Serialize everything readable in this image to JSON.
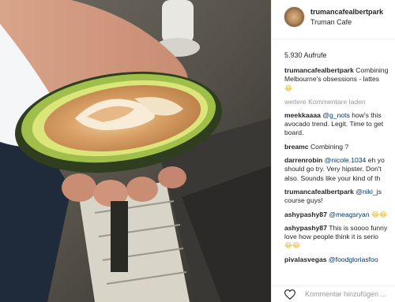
{
  "post": {
    "username": "trumancafealbertpark",
    "location": "Truman Cafe",
    "views": "5.930 Aufrufe",
    "load_more": "weitere Kommentare laden",
    "add_comment_placeholder": "Kommentar hinzufügen ..."
  },
  "caption": {
    "user": "trumancafealbertpark",
    "line1": "Combining",
    "line2": "Melbourne's obsessions - lattes",
    "line3": "😂"
  },
  "comments": [
    {
      "user": "meekkaaaa",
      "mention": "@g_nots",
      "text1": " how's this",
      "line2": "avocado trend. Legit. Time to get",
      "line3": "board."
    },
    {
      "user": "breamc",
      "text1": " Combining ?"
    },
    {
      "user": "darrenrobin",
      "mention": "@nicole.1034",
      "text1": " eh yo",
      "line2": "should go try. Very hipster. Don't",
      "line3": "also. Sounds like your kind of th"
    },
    {
      "user": "trumancafealbertpark",
      "mention": "@niki_js",
      "text1": "",
      "line2": "course guys!"
    },
    {
      "user": "ashypashy87",
      "mention": "@meagsryan",
      "text1": " 😂😂"
    },
    {
      "user": "ashypashy87",
      "text1": " This is soooo funny",
      "line2": "love how people think it is serio",
      "line3": "😂😂"
    },
    {
      "user": "pivalasvegas",
      "mention": "@foodgloriasfoo",
      "text1": ""
    }
  ],
  "icons": {
    "heart": "heart-icon"
  }
}
